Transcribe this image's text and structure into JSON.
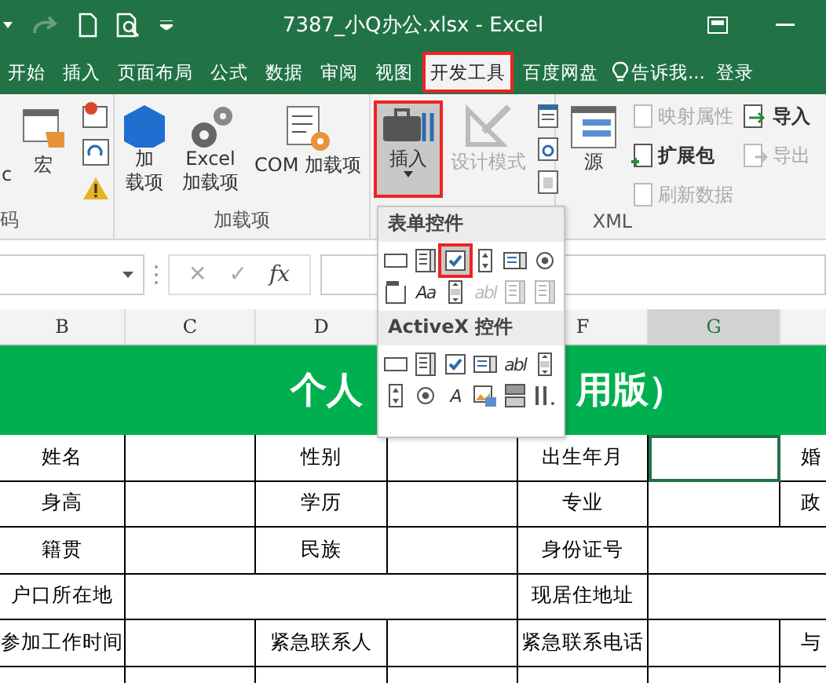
{
  "window": {
    "title": "7387_小Q办公.xlsx - Excel"
  },
  "tabs": [
    {
      "label": "开始",
      "selected": false,
      "highlighted": false
    },
    {
      "label": "插入",
      "selected": false,
      "highlighted": false
    },
    {
      "label": "页面布局",
      "selected": false,
      "highlighted": false
    },
    {
      "label": "公式",
      "selected": false,
      "highlighted": false
    },
    {
      "label": "数据",
      "selected": false,
      "highlighted": false
    },
    {
      "label": "审阅",
      "selected": false,
      "highlighted": false
    },
    {
      "label": "视图",
      "selected": false,
      "highlighted": false
    },
    {
      "label": "开发工具",
      "selected": true,
      "highlighted": true
    },
    {
      "label": "百度网盘",
      "selected": false,
      "highlighted": false
    }
  ],
  "tell_me": "告诉我...",
  "sign_in": "登录",
  "ribbon": {
    "code": {
      "label": "码",
      "vba": "c",
      "macro": "宏"
    },
    "addins": {
      "label": "加载项",
      "buttons": [
        {
          "kind": "addin",
          "lines": [
            "加",
            "载项"
          ]
        },
        {
          "kind": "excel",
          "lines": [
            "Excel",
            "加载项"
          ]
        },
        {
          "kind": "com",
          "lines": [
            "COM 加载项"
          ]
        }
      ]
    },
    "controls": {
      "insert": {
        "label": "插入",
        "pressed": true,
        "highlighted": true
      },
      "design": {
        "label": "设计模式",
        "disabled": true
      }
    },
    "xml": {
      "label": "XML",
      "source": "源",
      "items": [
        {
          "kind": "map",
          "label": "映射属性",
          "disabled": true
        },
        {
          "kind": "pack",
          "label": "扩展包",
          "disabled": false
        },
        {
          "kind": "refresh",
          "label": "刷新数据",
          "disabled": true
        }
      ],
      "side": [
        {
          "kind": "import",
          "label": "导入",
          "disabled": false
        },
        {
          "kind": "export",
          "label": "导出",
          "disabled": true
        }
      ]
    }
  },
  "formula_bar": {
    "cancel": "✕",
    "enter": "✓",
    "fx": "fx"
  },
  "columns": [
    {
      "label": "B",
      "selected": false
    },
    {
      "label": "C",
      "selected": false
    },
    {
      "label": "D",
      "selected": false
    },
    {
      "label": "F",
      "selected": false
    },
    {
      "label": "G",
      "selected": true
    }
  ],
  "sheet": {
    "title_parts": [
      "个人",
      "用版）"
    ],
    "rows": [
      [
        {
          "kind": "label",
          "text": "姓名"
        },
        {
          "kind": "blank",
          "selected": false
        },
        {
          "kind": "label",
          "text": "性别"
        },
        {
          "kind": "blank",
          "selected": false
        },
        {
          "kind": "label",
          "text": "出生年月"
        },
        {
          "kind": "blank",
          "selected": true
        },
        {
          "kind": "label",
          "text": "婚"
        }
      ],
      [
        {
          "kind": "label",
          "text": "身高"
        },
        {
          "kind": "blank",
          "selected": false
        },
        {
          "kind": "label",
          "text": "学历"
        },
        {
          "kind": "blank",
          "selected": false
        },
        {
          "kind": "label",
          "text": "专业"
        },
        {
          "kind": "blank",
          "selected": false
        },
        {
          "kind": "label",
          "text": "政"
        }
      ],
      [
        {
          "kind": "label",
          "text": "籍贯"
        },
        {
          "kind": "blank",
          "selected": false
        },
        {
          "kind": "label",
          "text": "民族"
        },
        {
          "kind": "blank",
          "selected": false
        },
        {
          "kind": "label",
          "text": "身份证号"
        },
        {
          "kind": "blank",
          "selected": false
        },
        {
          "kind": "merged"
        }
      ],
      [
        {
          "kind": "label",
          "text": "户口所在地"
        },
        {
          "kind": "blank",
          "selected": false
        },
        {
          "kind": "merged"
        },
        {
          "kind": "merged"
        },
        {
          "kind": "label",
          "text": "现居住地址"
        },
        {
          "kind": "blank",
          "selected": false
        },
        {
          "kind": "merged"
        }
      ],
      [
        {
          "kind": "label",
          "text": "参加工作时间"
        },
        {
          "kind": "blank",
          "selected": false
        },
        {
          "kind": "label",
          "text": "紧急联系人"
        },
        {
          "kind": "blank",
          "selected": false
        },
        {
          "kind": "label",
          "text": "紧急联系电话"
        },
        {
          "kind": "blank",
          "selected": false
        },
        {
          "kind": "label",
          "text": "与"
        }
      ],
      [
        {
          "kind": "blank",
          "selected": false
        },
        {
          "kind": "blank",
          "selected": false
        },
        {
          "kind": "blank",
          "selected": false
        },
        {
          "kind": "blank",
          "selected": false
        },
        {
          "kind": "blank",
          "selected": false
        },
        {
          "kind": "blank",
          "selected": false
        }
      ]
    ]
  },
  "insert_menu": {
    "sections": [
      {
        "title": "表单控件",
        "controls": [
          {
            "kind": "button",
            "selected": false,
            "disabled": false
          },
          {
            "kind": "combo",
            "selected": false,
            "disabled": false
          },
          {
            "kind": "checkbox",
            "selected": true,
            "disabled": false
          },
          {
            "kind": "spin",
            "selected": false,
            "disabled": false
          },
          {
            "kind": "list",
            "selected": false,
            "disabled": false
          },
          {
            "kind": "option",
            "selected": false,
            "disabled": false
          },
          {
            "kind": "group",
            "selected": false,
            "disabled": false
          },
          {
            "kind": "text",
            "glyph": "Aa",
            "selected": false,
            "disabled": false
          },
          {
            "kind": "scroll",
            "selected": false,
            "disabled": false
          },
          {
            "kind": "text",
            "glyph": "abl",
            "selected": false,
            "disabled": true
          },
          {
            "kind": "combo",
            "selected": false,
            "disabled": true
          },
          {
            "kind": "combo",
            "selected": false,
            "disabled": true
          }
        ]
      },
      {
        "title": "ActiveX 控件",
        "controls": [
          {
            "kind": "button",
            "selected": false,
            "disabled": false
          },
          {
            "kind": "combo",
            "selected": false,
            "disabled": false
          },
          {
            "kind": "checkbox",
            "selected": false,
            "disabled": false
          },
          {
            "kind": "list",
            "selected": false,
            "disabled": false
          },
          {
            "kind": "text",
            "glyph": "abl",
            "selected": false,
            "disabled": false
          },
          {
            "kind": "scroll",
            "selected": false,
            "disabled": false
          },
          {
            "kind": "spin",
            "selected": false,
            "disabled": false
          },
          {
            "kind": "option",
            "selected": false,
            "disabled": false
          },
          {
            "kind": "text",
            "glyph": "A",
            "selected": false,
            "disabled": false
          },
          {
            "kind": "image",
            "selected": false,
            "disabled": false
          },
          {
            "kind": "toggle",
            "selected": false,
            "disabled": false
          },
          {
            "kind": "more",
            "selected": false,
            "disabled": false
          }
        ]
      }
    ]
  }
}
